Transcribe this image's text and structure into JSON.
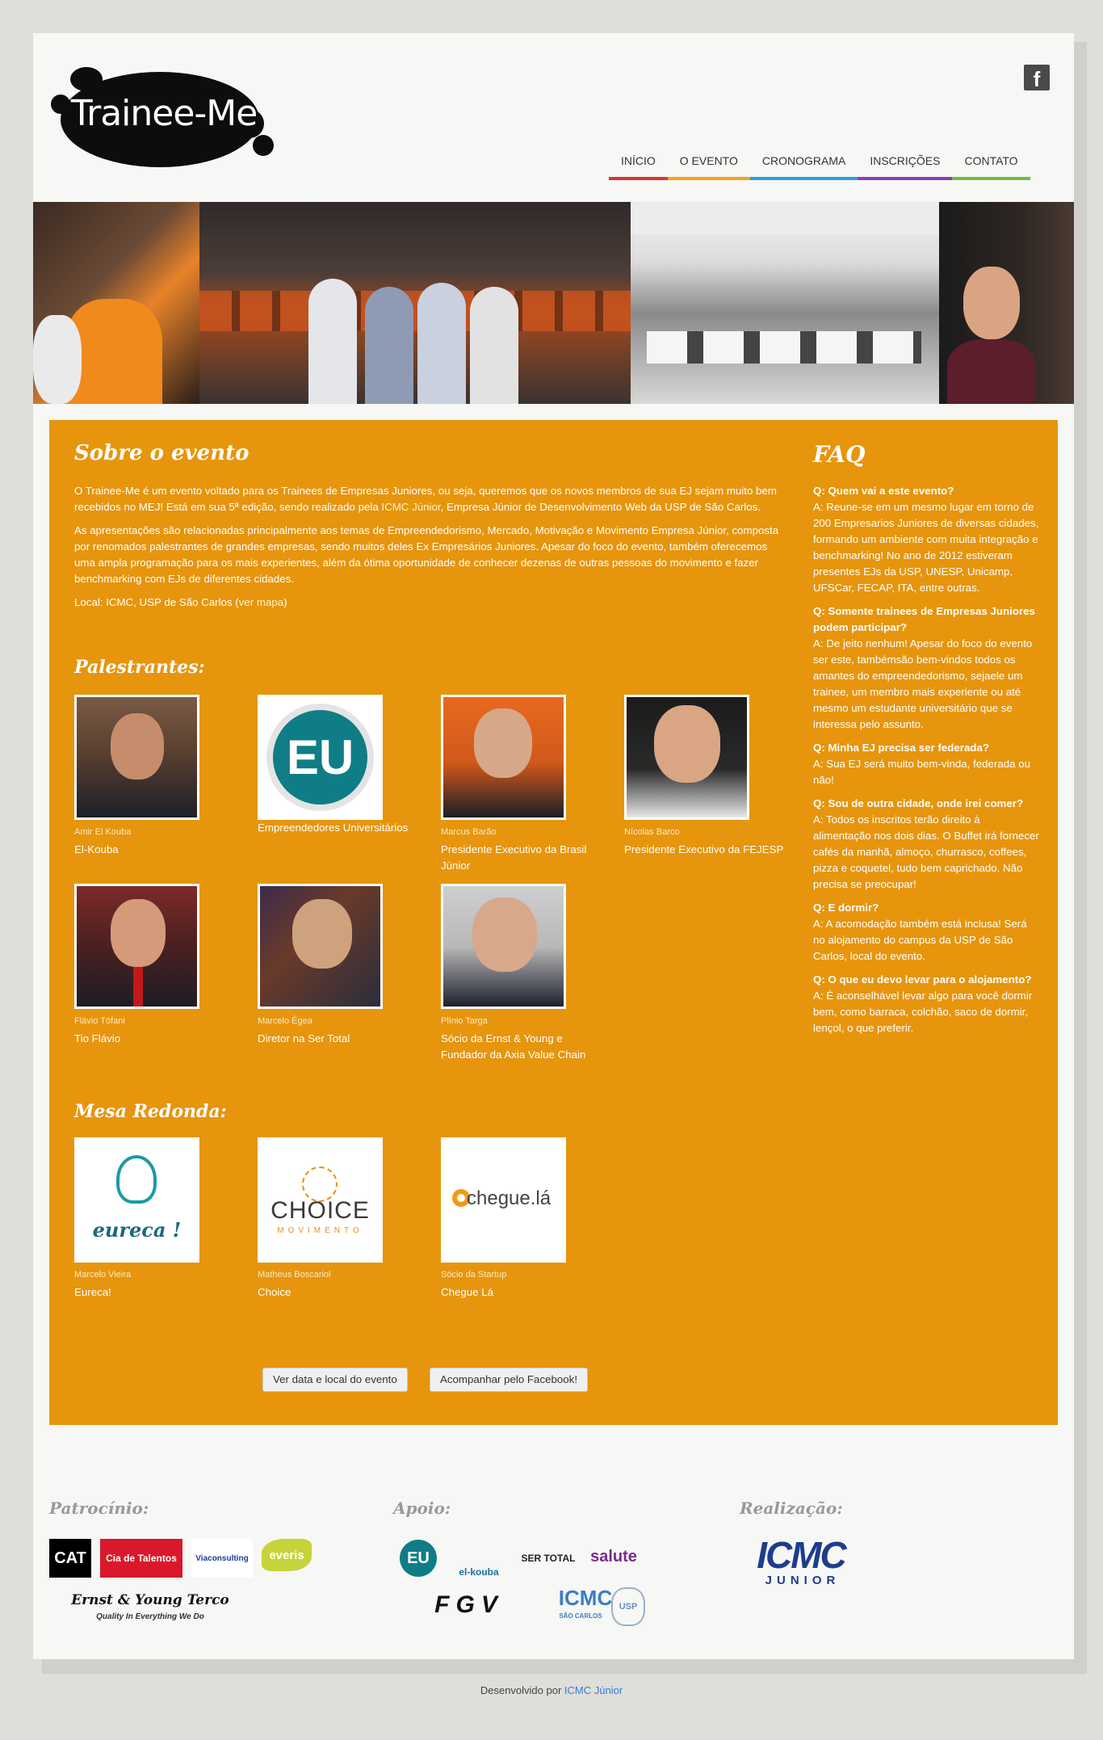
{
  "header": {
    "logo_text": "Trainee-Me",
    "facebook_icon": "f",
    "nav": [
      {
        "label": "INÍCIO",
        "color": "#d43a2f"
      },
      {
        "label": "O EVENTO",
        "color": "#f4a31c"
      },
      {
        "label": "CRONOGRAMA",
        "color": "#2aa3d8"
      },
      {
        "label": "INSCRIÇÕES",
        "color": "#8a3fb5"
      },
      {
        "label": "CONTATO",
        "color": "#6cbf3b"
      }
    ]
  },
  "about": {
    "title": "Sobre o evento",
    "p1_a": "O Trainee-Me é um evento voltado para os Trainees de Empresas Juniores, ou seja, queremos que os novos membros de sua EJ sejam muito bem recebidos no MEJ! Está em sua 5ª edição, sendo realizado pela ",
    "p1_link": "ICMC Júnior",
    "p1_b": ", Empresa Júnior de Desenvolvimento Web da USP de São Carlos.",
    "p2": "As apresentações são relacionadas principalmente aos temas de Empreendedorismo, Mercado, Motivação e Movimento Empresa Júnior, composta por renomados palestrantes de grandes empresas, sendo muitos deles Ex Empresários Juniores. Apesar do foco do evento, também oferecemos uma ampla programação para os mais experientes, além da ótima oportunidade de conhecer dezenas de outras pessoas do movimento e  fazer benchmarking com EJs de diferentes cidades.",
    "local_label": "Local: ICMC, USP de São Carlos (",
    "local_link": "ver mapa",
    "local_end": ")"
  },
  "speakers_title": "Palestrantes:",
  "speakers": [
    {
      "name": "Amir El Kouba",
      "role": "El-Kouba"
    },
    {
      "name": "",
      "role": "Empreendedores Universitários"
    },
    {
      "name": "Marcus Barão",
      "role": "Presidente Executivo da Brasil Júnior"
    },
    {
      "name": "Nícolas Barco",
      "role": "Presidente Executivo da FEJESP"
    },
    {
      "name": "Flávio Tófani",
      "role": "Tio Flávio"
    },
    {
      "name": "Marcelo Égea",
      "role": "Diretor na Ser Total"
    },
    {
      "name": "Plínio Targa",
      "role": "Sócio da Ernst & Young e Fundador da Axia Value Chain"
    }
  ],
  "eu_logo_text": "EU",
  "round_title": "Mesa Redonda:",
  "round": [
    {
      "name": "Marcelo Vieira",
      "role": "Eureca!",
      "logo": "eureca !"
    },
    {
      "name": "Matheus Boscariol",
      "role": "Choice",
      "logo": "CHOICE",
      "logo_sub": "MOVIMENTO"
    },
    {
      "name": "Sócio da Startup",
      "role": "Chegue Lá",
      "logo": "chegue.lá"
    }
  ],
  "buttons": {
    "date": "Ver data e local do evento",
    "facebook": "Acompanhar pelo Facebook!"
  },
  "faq": {
    "title": "FAQ",
    "items": [
      {
        "q": "Q: Quem vai a este evento?",
        "a": "A: Reune-se em um mesmo lugar em torno de 200 Empresarios Juniores de diversas cidades, formando um ambiente com muita integração e benchmarking! No ano de 2012 estiveram presentes EJs da USP, UNESP, Unicamp, UFSCar, FECAP, ITA, entre outras."
      },
      {
        "q": "Q: Somente trainees de Empresas Juniores podem participar?",
        "a": "A: De jeito nenhum! Apesar do foco do evento ser este, tambémsão bem-vindos todos os amantes do empreendedorismo, sejaele um trainee, um membro mais experiente ou até mesmo um estudante universitário que se interessa pelo assunto."
      },
      {
        "q": "Q: Minha EJ precisa ser federada?",
        "a": "A: Sua EJ será muito bem-vinda, federada ou não!"
      },
      {
        "q": "Q: Sou de outra cidade, onde irei comer?",
        "a": "A: Todos os inscritos terão direito à alimentação nos dois dias. O Buffet irá fornecer cafés da manhã, almoço, churrasco, coffees, pizza e coquetel, tudo bem caprichado. Não precisa se preocupar!"
      },
      {
        "q": "Q: E dormir?",
        "a": "A: A acomodação também está inclusa! Será no alojamento do campus da USP de São Carlos, local do evento."
      },
      {
        "q": "Q: O que eu devo levar para o alojamento?",
        "a": "A: É aconselhável levar algo para você dormir bem, como barraca, colchão, saco de dormir, lençol, o que preferir."
      }
    ]
  },
  "footer": {
    "sponsors_title": "Patrocínio:",
    "support_title": "Apoio:",
    "realization_title": "Realização:",
    "sponsors": [
      "CAT",
      "Cia de Talentos",
      "Viaconsulting",
      "everis",
      "Ernst & Young Terco",
      "Quality In Everything We Do"
    ],
    "support": [
      "EU",
      "el-kouba",
      "SER TOTAL",
      "salute",
      "FGV",
      "ICMC",
      "SÃO CARLOS",
      "USP"
    ],
    "realization": [
      "ICMC",
      "JUNIOR"
    ],
    "dev_label": "Desenvolvido por ",
    "dev_link": "ICMC Júnior"
  },
  "colors": {
    "accent": "#e6950d",
    "page_bg": "#dededa"
  }
}
